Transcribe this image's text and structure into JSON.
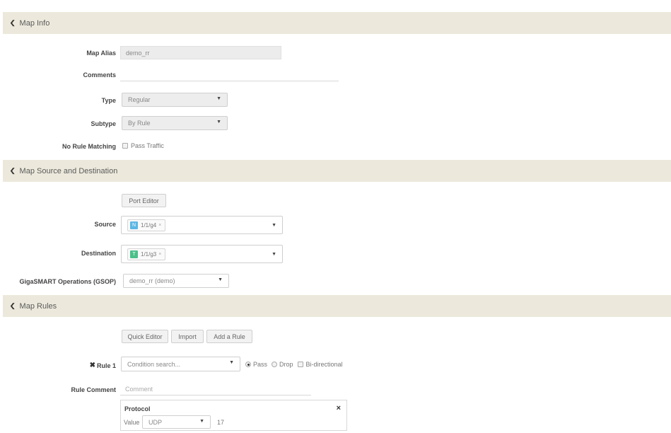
{
  "sections": {
    "map_info": "Map Info",
    "source_destination": "Map Source and Destination",
    "map_rules": "Map Rules"
  },
  "map_info": {
    "alias_label": "Map Alias",
    "alias_value": "demo_rr",
    "comments_label": "Comments",
    "comments_value": "",
    "type_label": "Type",
    "type_value": "Regular",
    "subtype_label": "Subtype",
    "subtype_value": "By Rule",
    "no_rule_label": "No Rule Matching",
    "pass_traffic_label": "Pass Traffic"
  },
  "source_dest": {
    "port_editor": "Port Editor",
    "source_label": "Source",
    "source_tag": {
      "badge": "N",
      "text": "1/1/g4",
      "color": "#5bb7e5"
    },
    "destination_label": "Destination",
    "destination_tag": {
      "badge": "T",
      "text": "1/1/g3",
      "color": "#4cc08a"
    },
    "gsop_label": "GigaSMART Operations (GSOP)",
    "gsop_value": "demo_rr (demo)"
  },
  "rules": {
    "quick_editor": "Quick Editor",
    "import": "Import",
    "add_rule": "Add a Rule",
    "rule1_label": "Rule 1",
    "condition_placeholder": "Condition search...",
    "pass": "Pass",
    "drop": "Drop",
    "bidirectional": "Bi-directional",
    "rule_comment_label": "Rule Comment",
    "comment_placeholder": "Comment",
    "protocol_title": "Protocol",
    "value_label": "Value",
    "protocol_value": "UDP",
    "protocol_number": "17"
  }
}
